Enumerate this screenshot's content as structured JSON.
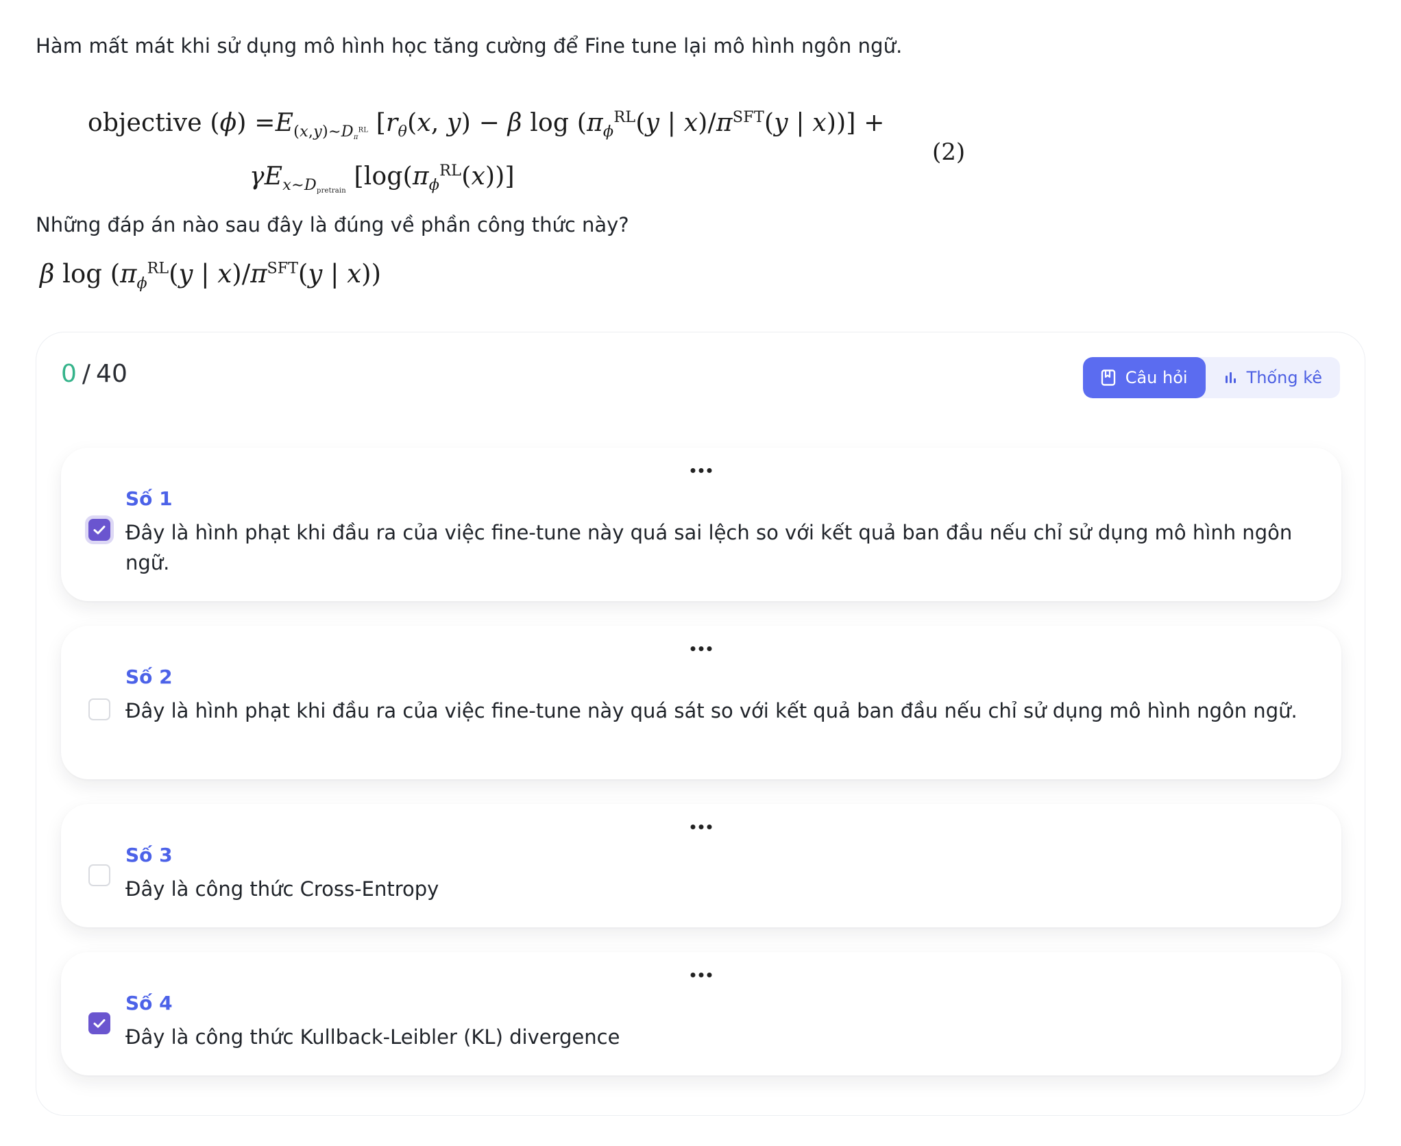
{
  "question": {
    "intro": "Hàm mất mát khi sử dụng mô hình học tăng cường để Fine tune lại mô hình ngôn ngữ.",
    "equation_number": "(2)",
    "prompt": "Những đáp án nào sau đây là đúng về phần công thức này?"
  },
  "panel": {
    "score_current": "0",
    "score_separator": "/",
    "score_total": "40",
    "tabs": [
      {
        "label": "Câu hỏi",
        "icon": "bookmark-icon",
        "active": true
      },
      {
        "label": "Thống kê",
        "icon": "bar-chart-icon",
        "active": false
      }
    ]
  },
  "options": [
    {
      "label": "Số 1",
      "text": "Đây là hình phạt khi đầu ra của việc fine-tune này quá sai lệch so với kết quả ban đầu nếu chỉ sử dụng mô hình ngôn ngữ.",
      "checked": true
    },
    {
      "label": "Số 2",
      "text": "Đây là hình phạt khi đầu ra của việc fine-tune này quá sát so với kết quả ban đầu nếu chỉ sử dụng mô hình ngôn ngữ.",
      "checked": false
    },
    {
      "label": "Số 3",
      "text": "Đây là công thức Cross-Entropy",
      "checked": false
    },
    {
      "label": "Số 4",
      "text": "Đây là công thức Kullback-Leibler (KL) divergence",
      "checked": true
    }
  ],
  "colors": {
    "accent": "#5b6cf0",
    "label": "#4c62e8",
    "checkbox_checked": "#6a55cf",
    "score_current": "#34b38a"
  }
}
